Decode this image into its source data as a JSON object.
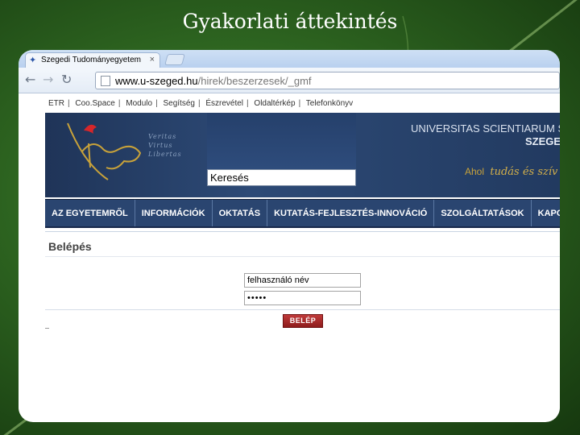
{
  "slide": {
    "title": "Gyakorlati áttekintés"
  },
  "browser": {
    "tab_title": "Szegedi Tudományegyetem",
    "tab_close": "×",
    "url_host": "www.u-szeged.hu",
    "url_path": "/hirek/beszerzesek/_gmf"
  },
  "toplinks": [
    "ETR",
    "Coo.Space",
    "Modulo",
    "Segítség",
    "Észrevétel",
    "Oldaltérkép",
    "Telefonkönyv"
  ],
  "toplinks_separator": "|",
  "banner": {
    "motto_lines": [
      "Veritas",
      "Virtus",
      "Libertas"
    ],
    "search_value": "Keresés",
    "university_name": "UNIVERSITAS SCIENTIARUM S",
    "city": "SZEGE",
    "tagline_prefix": "Ahol",
    "tagline_script": "tudás és szív"
  },
  "nav": [
    "AZ EGYETEMRŐL",
    "INFORMÁCIÓK",
    "OKTATÁS",
    "KUTATÁS-FEJLESZTÉS-INNOVÁCIÓ",
    "SZOLGÁLTATÁSOK",
    "KAPC"
  ],
  "login": {
    "title": "Belépés",
    "username_value": "felhasználó név",
    "password_value": "•••••",
    "submit_label": "BELÉP"
  },
  "colors": {
    "banner_bg": "#2a4570",
    "login_button": "#a82828",
    "tagline_gold": "#c8a23a"
  }
}
